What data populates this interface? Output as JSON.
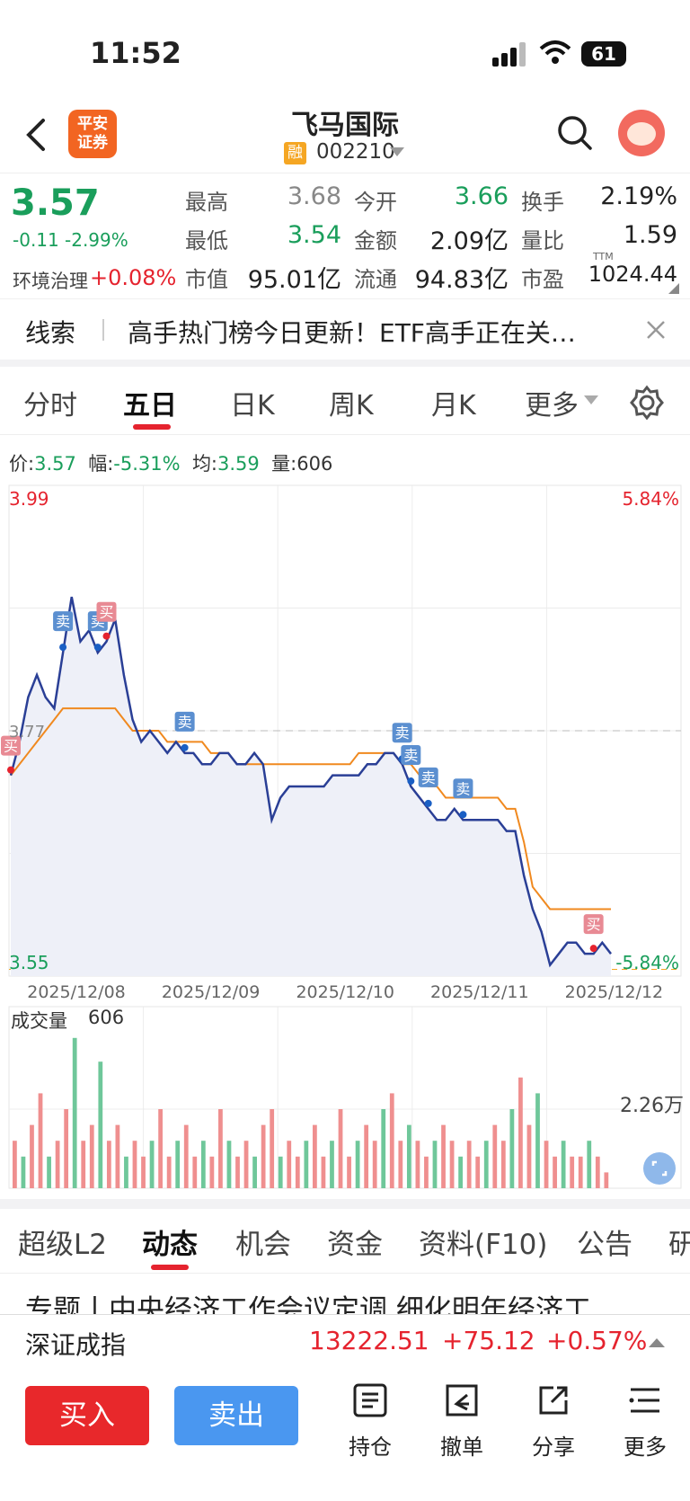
{
  "status_bar": {
    "time": "11:52",
    "battery": "61"
  },
  "nav": {
    "broker_logo": "平安\n证券",
    "stock_name": "飞马国际",
    "margin_badge": "融",
    "stock_code": "002210"
  },
  "quote": {
    "price": "3.57",
    "change": "-0.11",
    "change_pct": "-2.99%",
    "sector_label": "环境治理",
    "sector_change": "+0.08%",
    "fields": [
      {
        "label": "最高",
        "value": "3.68"
      },
      {
        "label": "今开",
        "value": "3.66"
      },
      {
        "label": "换手",
        "value": "2.19%"
      },
      {
        "label": "最低",
        "value": "3.54"
      },
      {
        "label": "金额",
        "value": "2.09亿"
      },
      {
        "label": "量比",
        "value": "1.59"
      },
      {
        "label": "市值",
        "value": "95.01亿"
      },
      {
        "label": "流通",
        "value": "94.83亿"
      },
      {
        "label": "市盈",
        "value": "1024.44"
      }
    ],
    "ttm": "TTM"
  },
  "clue": {
    "label": "线索",
    "text": "高手热门榜今日更新！ETF高手正在关…"
  },
  "chart_tabs": [
    "分时",
    "五日",
    "日K",
    "周K",
    "月K",
    "更多"
  ],
  "info_bar": {
    "price_label": "价:",
    "price": "3.57",
    "amp_label": "幅:",
    "amp": "-5.31%",
    "avg_label": "均:",
    "avg": "3.59",
    "vol_label": "量:",
    "vol": "606"
  },
  "chart_data": {
    "type": "line",
    "y_max_label": "3.99",
    "y_min_label": "3.55",
    "y_mid_label": "3.77",
    "pct_max_label": "5.84%",
    "pct_min_label": "-5.84%",
    "x_labels": [
      "2025/12/08",
      "2025/12/09",
      "2025/12/10",
      "2025/12/11",
      "2025/12/12"
    ],
    "ylim": [
      3.55,
      3.99
    ],
    "series": [
      {
        "values": [
          3.73,
          3.76,
          3.8,
          3.82,
          3.8,
          3.79,
          3.84,
          3.89,
          3.85,
          3.86,
          3.84,
          3.85,
          3.87,
          3.82,
          3.78,
          3.76,
          3.77,
          3.76,
          3.75,
          3.76,
          3.75,
          3.75,
          3.74,
          3.74,
          3.75,
          3.75,
          3.74,
          3.74,
          3.75,
          3.74,
          3.69,
          3.71,
          3.72,
          3.72,
          3.72,
          3.72,
          3.72,
          3.73,
          3.73,
          3.73,
          3.73,
          3.74,
          3.74,
          3.75,
          3.75,
          3.74,
          3.72,
          3.71,
          3.7,
          3.69,
          3.69,
          3.7,
          3.69,
          3.69,
          3.69,
          3.69,
          3.69,
          3.68,
          3.68,
          3.64,
          3.61,
          3.59,
          3.56,
          3.57,
          3.58,
          3.58,
          3.57,
          3.57,
          3.58,
          3.57
        ]
      },
      {
        "values": [
          3.73,
          3.74,
          3.75,
          3.76,
          3.77,
          3.78,
          3.79,
          3.79,
          3.79,
          3.79,
          3.79,
          3.79,
          3.79,
          3.78,
          3.77,
          3.77,
          3.77,
          3.77,
          3.76,
          3.76,
          3.76,
          3.76,
          3.76,
          3.75,
          3.75,
          3.75,
          3.74,
          3.74,
          3.74,
          3.74,
          3.74,
          3.74,
          3.74,
          3.74,
          3.74,
          3.74,
          3.74,
          3.74,
          3.74,
          3.74,
          3.75,
          3.75,
          3.75,
          3.75,
          3.75,
          3.74,
          3.74,
          3.73,
          3.72,
          3.72,
          3.71,
          3.71,
          3.71,
          3.71,
          3.71,
          3.71,
          3.71,
          3.7,
          3.7,
          3.67,
          3.63,
          3.62,
          3.61,
          3.61,
          3.61,
          3.61,
          3.61,
          3.61,
          3.61,
          3.61
        ]
      }
    ],
    "markers": [
      {
        "label": "买",
        "i": 0,
        "kind": "buy"
      },
      {
        "label": "卖",
        "i": 6,
        "kind": "sell"
      },
      {
        "label": "卖",
        "i": 10,
        "kind": "sell"
      },
      {
        "label": "买",
        "i": 11,
        "kind": "buy"
      },
      {
        "label": "卖",
        "i": 20,
        "kind": "sell"
      },
      {
        "label": "卖",
        "i": 45,
        "kind": "sell"
      },
      {
        "label": "卖",
        "i": 46,
        "kind": "sell"
      },
      {
        "label": "卖",
        "i": 48,
        "kind": "sell"
      },
      {
        "label": "卖",
        "i": 52,
        "kind": "sell"
      },
      {
        "label": "买",
        "i": 67,
        "kind": "buy"
      }
    ],
    "volume": {
      "label": "成交量",
      "value": "606",
      "max_label": "2.26万",
      "bars": [
        0.3,
        0.2,
        0.4,
        0.6,
        0.2,
        0.3,
        0.5,
        0.95,
        0.3,
        0.4,
        0.8,
        0.3,
        0.4,
        0.2,
        0.3,
        0.2,
        0.3,
        0.5,
        0.2,
        0.3,
        0.4,
        0.2,
        0.3,
        0.2,
        0.5,
        0.3,
        0.2,
        0.3,
        0.2,
        0.4,
        0.5,
        0.2,
        0.3,
        0.2,
        0.3,
        0.4,
        0.2,
        0.3,
        0.5,
        0.2,
        0.3,
        0.4,
        0.3,
        0.5,
        0.6,
        0.3,
        0.4,
        0.3,
        0.2,
        0.3,
        0.4,
        0.3,
        0.2,
        0.3,
        0.2,
        0.3,
        0.4,
        0.3,
        0.5,
        0.7,
        0.4,
        0.6,
        0.3,
        0.2,
        0.3,
        0.2,
        0.2,
        0.3,
        0.2,
        0.1
      ]
    }
  },
  "bottom_tabs": [
    "超级L2",
    "动态",
    "机会",
    "资金",
    "资料(F10)",
    "公告",
    "研"
  ],
  "news_title": "专题丨中央经济工作会议定调 细化明年经济工",
  "index_bar": {
    "name": "深证成指",
    "value": "13222.51",
    "change": "+75.12",
    "pct": "+0.57%"
  },
  "toolbar": {
    "buy": "买入",
    "sell": "卖出",
    "tools": [
      "持仓",
      "撤单",
      "分享",
      "更多"
    ]
  }
}
